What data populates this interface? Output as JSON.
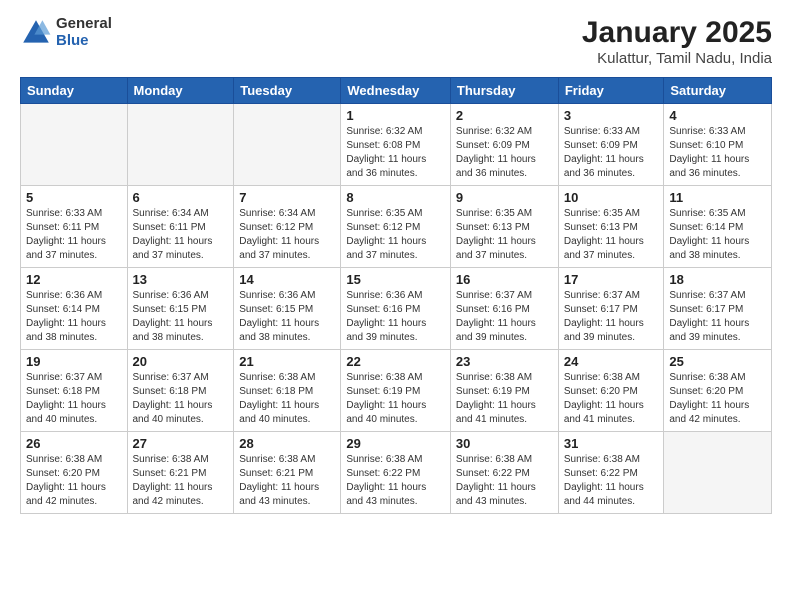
{
  "header": {
    "logo_general": "General",
    "logo_blue": "Blue",
    "title": "January 2025",
    "subtitle": "Kulattur, Tamil Nadu, India"
  },
  "days_of_week": [
    "Sunday",
    "Monday",
    "Tuesday",
    "Wednesday",
    "Thursday",
    "Friday",
    "Saturday"
  ],
  "weeks": [
    [
      {
        "day": "",
        "sunrise": "",
        "sunset": "",
        "daylight": ""
      },
      {
        "day": "",
        "sunrise": "",
        "sunset": "",
        "daylight": ""
      },
      {
        "day": "",
        "sunrise": "",
        "sunset": "",
        "daylight": ""
      },
      {
        "day": "1",
        "sunrise": "Sunrise: 6:32 AM",
        "sunset": "Sunset: 6:08 PM",
        "daylight": "Daylight: 11 hours and 36 minutes."
      },
      {
        "day": "2",
        "sunrise": "Sunrise: 6:32 AM",
        "sunset": "Sunset: 6:09 PM",
        "daylight": "Daylight: 11 hours and 36 minutes."
      },
      {
        "day": "3",
        "sunrise": "Sunrise: 6:33 AM",
        "sunset": "Sunset: 6:09 PM",
        "daylight": "Daylight: 11 hours and 36 minutes."
      },
      {
        "day": "4",
        "sunrise": "Sunrise: 6:33 AM",
        "sunset": "Sunset: 6:10 PM",
        "daylight": "Daylight: 11 hours and 36 minutes."
      }
    ],
    [
      {
        "day": "5",
        "sunrise": "Sunrise: 6:33 AM",
        "sunset": "Sunset: 6:11 PM",
        "daylight": "Daylight: 11 hours and 37 minutes."
      },
      {
        "day": "6",
        "sunrise": "Sunrise: 6:34 AM",
        "sunset": "Sunset: 6:11 PM",
        "daylight": "Daylight: 11 hours and 37 minutes."
      },
      {
        "day": "7",
        "sunrise": "Sunrise: 6:34 AM",
        "sunset": "Sunset: 6:12 PM",
        "daylight": "Daylight: 11 hours and 37 minutes."
      },
      {
        "day": "8",
        "sunrise": "Sunrise: 6:35 AM",
        "sunset": "Sunset: 6:12 PM",
        "daylight": "Daylight: 11 hours and 37 minutes."
      },
      {
        "day": "9",
        "sunrise": "Sunrise: 6:35 AM",
        "sunset": "Sunset: 6:13 PM",
        "daylight": "Daylight: 11 hours and 37 minutes."
      },
      {
        "day": "10",
        "sunrise": "Sunrise: 6:35 AM",
        "sunset": "Sunset: 6:13 PM",
        "daylight": "Daylight: 11 hours and 37 minutes."
      },
      {
        "day": "11",
        "sunrise": "Sunrise: 6:35 AM",
        "sunset": "Sunset: 6:14 PM",
        "daylight": "Daylight: 11 hours and 38 minutes."
      }
    ],
    [
      {
        "day": "12",
        "sunrise": "Sunrise: 6:36 AM",
        "sunset": "Sunset: 6:14 PM",
        "daylight": "Daylight: 11 hours and 38 minutes."
      },
      {
        "day": "13",
        "sunrise": "Sunrise: 6:36 AM",
        "sunset": "Sunset: 6:15 PM",
        "daylight": "Daylight: 11 hours and 38 minutes."
      },
      {
        "day": "14",
        "sunrise": "Sunrise: 6:36 AM",
        "sunset": "Sunset: 6:15 PM",
        "daylight": "Daylight: 11 hours and 38 minutes."
      },
      {
        "day": "15",
        "sunrise": "Sunrise: 6:36 AM",
        "sunset": "Sunset: 6:16 PM",
        "daylight": "Daylight: 11 hours and 39 minutes."
      },
      {
        "day": "16",
        "sunrise": "Sunrise: 6:37 AM",
        "sunset": "Sunset: 6:16 PM",
        "daylight": "Daylight: 11 hours and 39 minutes."
      },
      {
        "day": "17",
        "sunrise": "Sunrise: 6:37 AM",
        "sunset": "Sunset: 6:17 PM",
        "daylight": "Daylight: 11 hours and 39 minutes."
      },
      {
        "day": "18",
        "sunrise": "Sunrise: 6:37 AM",
        "sunset": "Sunset: 6:17 PM",
        "daylight": "Daylight: 11 hours and 39 minutes."
      }
    ],
    [
      {
        "day": "19",
        "sunrise": "Sunrise: 6:37 AM",
        "sunset": "Sunset: 6:18 PM",
        "daylight": "Daylight: 11 hours and 40 minutes."
      },
      {
        "day": "20",
        "sunrise": "Sunrise: 6:37 AM",
        "sunset": "Sunset: 6:18 PM",
        "daylight": "Daylight: 11 hours and 40 minutes."
      },
      {
        "day": "21",
        "sunrise": "Sunrise: 6:38 AM",
        "sunset": "Sunset: 6:18 PM",
        "daylight": "Daylight: 11 hours and 40 minutes."
      },
      {
        "day": "22",
        "sunrise": "Sunrise: 6:38 AM",
        "sunset": "Sunset: 6:19 PM",
        "daylight": "Daylight: 11 hours and 40 minutes."
      },
      {
        "day": "23",
        "sunrise": "Sunrise: 6:38 AM",
        "sunset": "Sunset: 6:19 PM",
        "daylight": "Daylight: 11 hours and 41 minutes."
      },
      {
        "day": "24",
        "sunrise": "Sunrise: 6:38 AM",
        "sunset": "Sunset: 6:20 PM",
        "daylight": "Daylight: 11 hours and 41 minutes."
      },
      {
        "day": "25",
        "sunrise": "Sunrise: 6:38 AM",
        "sunset": "Sunset: 6:20 PM",
        "daylight": "Daylight: 11 hours and 42 minutes."
      }
    ],
    [
      {
        "day": "26",
        "sunrise": "Sunrise: 6:38 AM",
        "sunset": "Sunset: 6:20 PM",
        "daylight": "Daylight: 11 hours and 42 minutes."
      },
      {
        "day": "27",
        "sunrise": "Sunrise: 6:38 AM",
        "sunset": "Sunset: 6:21 PM",
        "daylight": "Daylight: 11 hours and 42 minutes."
      },
      {
        "day": "28",
        "sunrise": "Sunrise: 6:38 AM",
        "sunset": "Sunset: 6:21 PM",
        "daylight": "Daylight: 11 hours and 43 minutes."
      },
      {
        "day": "29",
        "sunrise": "Sunrise: 6:38 AM",
        "sunset": "Sunset: 6:22 PM",
        "daylight": "Daylight: 11 hours and 43 minutes."
      },
      {
        "day": "30",
        "sunrise": "Sunrise: 6:38 AM",
        "sunset": "Sunset: 6:22 PM",
        "daylight": "Daylight: 11 hours and 43 minutes."
      },
      {
        "day": "31",
        "sunrise": "Sunrise: 6:38 AM",
        "sunset": "Sunset: 6:22 PM",
        "daylight": "Daylight: 11 hours and 44 minutes."
      },
      {
        "day": "",
        "sunrise": "",
        "sunset": "",
        "daylight": ""
      }
    ]
  ]
}
